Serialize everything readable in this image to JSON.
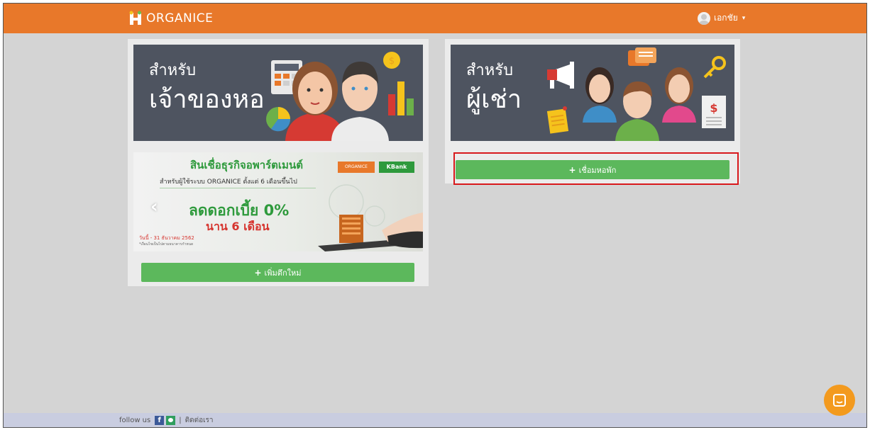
{
  "navbar": {
    "brand": "ORGANICE",
    "user_name": "เอกชัย",
    "caret": "▾"
  },
  "owner_card": {
    "banner_line1": "สำหรับ",
    "banner_line2": "เจ้าของหอ",
    "promo": {
      "title": "สินเชื่อธุรกิจอพาร์ตเมนต์",
      "subtitle": "สำหรับผู้ใช้ระบบ ORGANICE ตั้งแต่ 6 เดือนขึ้นไป",
      "main": "ลดดอกเบี้ย 0%",
      "duration": "นาน 6 เดือน",
      "date": "วันนี้ - 31 ธันวาคม 2562",
      "note": "*เงื่อนไขเป็นไปตามธนาคารกำหนด",
      "partner_badge_1": "ORGANICE",
      "partner_badge_2": "KBank",
      "prev_arrow": "‹"
    },
    "button_label": "เพิ่มตึกใหม่"
  },
  "tenant_card": {
    "banner_line1": "สำหรับ",
    "banner_line2": "ผู้เช่า",
    "button_label": "เชื่อมหอพัก"
  },
  "footer": {
    "follow_label": "follow us",
    "fb": "f",
    "separator": "|",
    "contact_label": "ติดต่อเรา"
  },
  "colors": {
    "navbar": "#e8782a",
    "button_green": "#5cb85c",
    "banner_bg": "#4e5460",
    "highlight_red": "#d8181c",
    "chat_orange": "#f39a1e"
  }
}
